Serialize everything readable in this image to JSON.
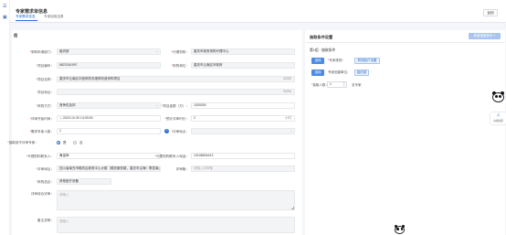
{
  "header": {
    "title": "专家需求单信息",
    "tabs": [
      {
        "label": "专家需求信息",
        "active": true
      },
      {
        "label": "专家抽取结果",
        "active": false
      }
    ],
    "back_label": "返回"
  },
  "form": {
    "section_title": "信",
    "fields": [
      {
        "label": "采购申请部门：",
        "value": "组织部",
        "required": true
      },
      {
        "label": "代理机构：",
        "value": "重庆市政府采购代理中心",
        "required": true
      },
      {
        "label": "项目编号：",
        "value": "6822341997",
        "required": true
      },
      {
        "label": "采购单位：",
        "value": "重庆市云南区市政府",
        "required": true
      },
      {
        "label": "项目名称：",
        "value": "重庆市云南区中医院机关维修改造采购项目",
        "required": true,
        "suffix": "0/200"
      },
      {
        "label": "项目地址：",
        "value": "",
        "required": false,
        "suffix": "0/200"
      },
      {
        "label": "采购方式：",
        "value": "竞争性谈判",
        "required": true
      },
      {
        "label": "项目金额（万）：",
        "value": "1000000",
        "required": true
      },
      {
        "label": "评审开始时间：",
        "value": "2023-10-30 14:30:00",
        "required": true
      },
      {
        "label": "预计评审时长：",
        "value": "2",
        "required": true,
        "suffix": "小时"
      },
      {
        "label": "需求专家人数：",
        "value": "1",
        "required": true
      },
      {
        "label": "评审地点：",
        "value": "",
        "required": true
      },
      {
        "label": "抽取前不评审专家：",
        "value": "",
        "required": true
      },
      {
        "label": "代理机构联系人：",
        "value": "黄金辉",
        "required": true
      },
      {
        "label": "代理机构联系人电话：",
        "value": "13108634413",
        "required": true
      },
      {
        "label": "评审地址：",
        "value": "四川省南充市顺庆区政府中心大楼（顺庆服务楼，重庆市沿海）联发南山",
        "required": true
      },
      {
        "label": "评审备：",
        "value": "",
        "required": false,
        "placeholder": "请输入评审备"
      },
      {
        "label": "采购品目：",
        "value": "其他医疗设备",
        "required": true
      },
      {
        "label": "评审综合评审：",
        "value": "",
        "required": false,
        "placeholder": "请输入"
      },
      {
        "label": "备注说明：",
        "value": "",
        "required": false,
        "placeholder": "请输入"
      }
    ],
    "radio_options": [
      "是",
      "否"
    ],
    "radio_selected": "是"
  },
  "conditions": {
    "title": "抽取条件设置",
    "add_label": "新增抽取条件 +",
    "group_title": "第1组 · 抽取条件",
    "select_label": "选择",
    "expert_category_label": "专家类别：",
    "expert_category_tag": "其他医疗设备",
    "avoid_label": "专家回避单位：",
    "avoid_tag": "组织部",
    "count_label": "抽取人数：",
    "count_value": "1",
    "count_unit": "名专家"
  },
  "floating": {
    "support_label": "在线客服"
  },
  "colors": {
    "accent": "#2c6fd6",
    "accent_light": "#a9c4ee",
    "required": "#e04343",
    "background": "#f4f6f9"
  }
}
